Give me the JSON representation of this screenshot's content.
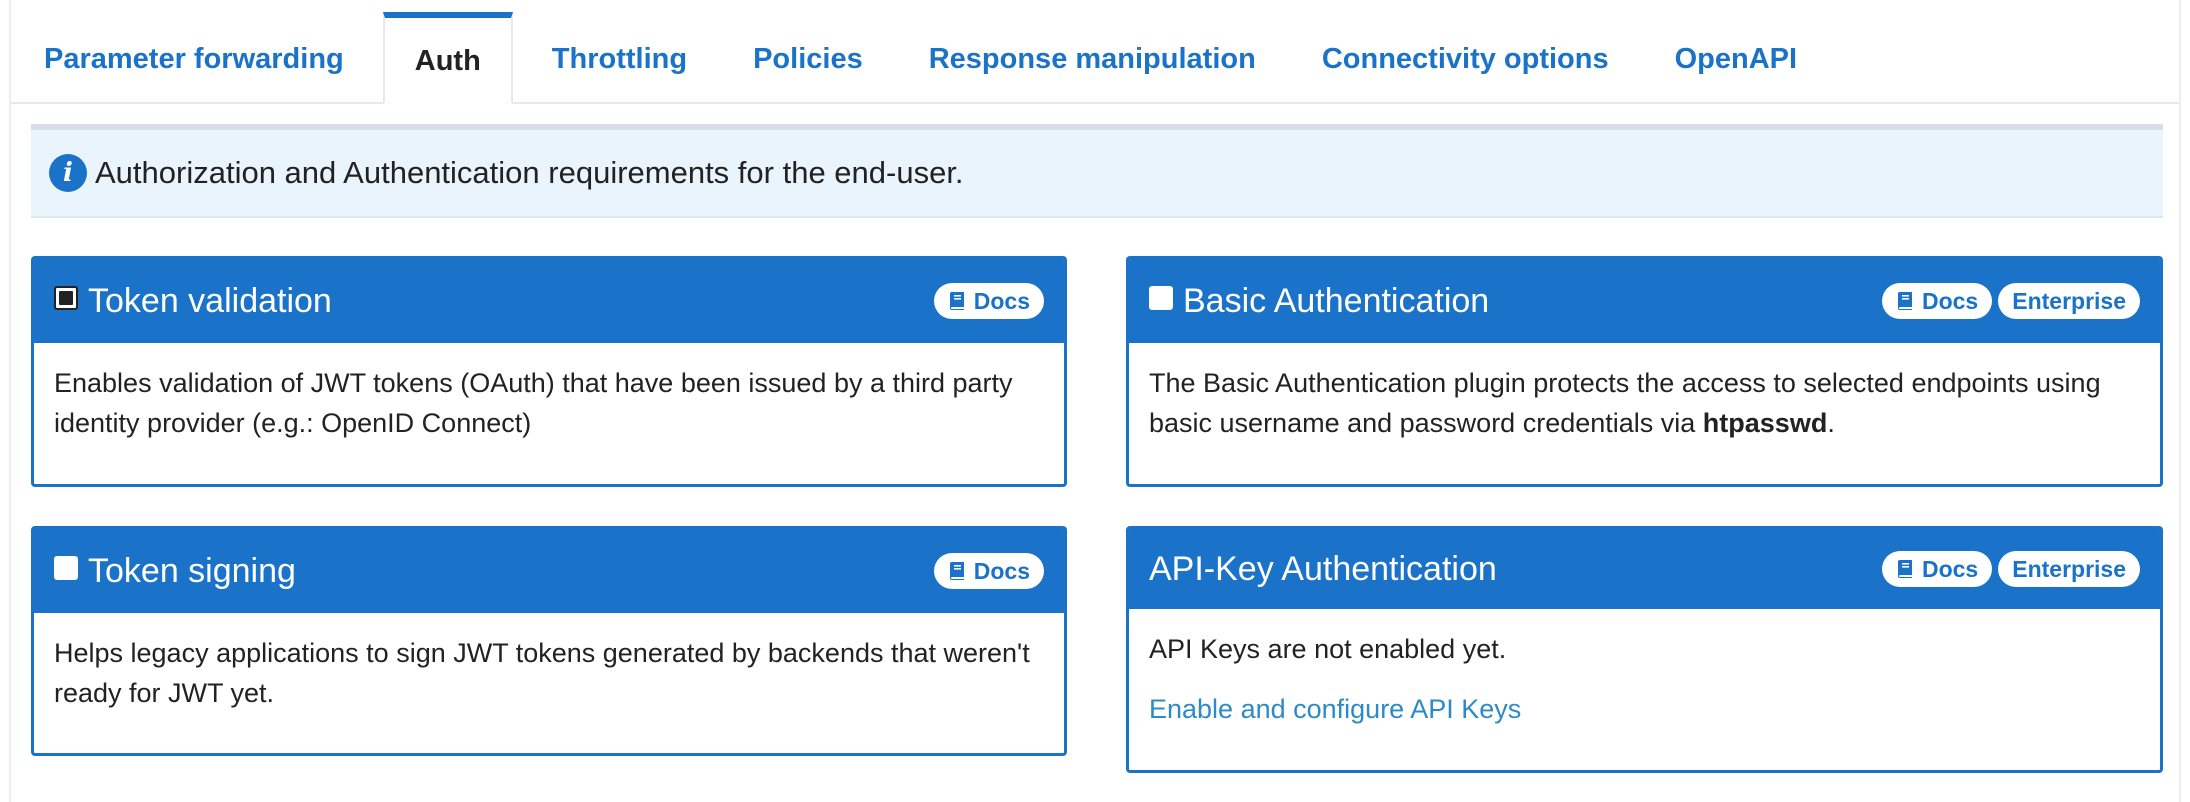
{
  "tabs": [
    {
      "label": "Parameter forwarding",
      "active": false
    },
    {
      "label": "Auth",
      "active": true
    },
    {
      "label": "Throttling",
      "active": false
    },
    {
      "label": "Policies",
      "active": false
    },
    {
      "label": "Response manipulation",
      "active": false
    },
    {
      "label": "Connectivity options",
      "active": false
    },
    {
      "label": "OpenAPI",
      "active": false
    }
  ],
  "info": {
    "icon": "info-icon",
    "text": "Authorization and Authentication requirements for the end-user."
  },
  "cards": {
    "token_validation": {
      "title": "Token validation",
      "checkbox_state": "indeterminate",
      "docs_label": "Docs",
      "description": "Enables validation of JWT tokens (OAuth) that have been issued by a third party identity provider (e.g.: OpenID Connect)"
    },
    "basic_auth": {
      "title": "Basic Authentication",
      "checkbox_state": "unchecked",
      "docs_label": "Docs",
      "enterprise_label": "Enterprise",
      "description_prefix": "The Basic Authentication plugin protects the access to selected endpoints using basic username and password credentials via ",
      "description_bold": "htpasswd",
      "description_suffix": "."
    },
    "token_signing": {
      "title": "Token signing",
      "checkbox_state": "unchecked",
      "docs_label": "Docs",
      "description": "Helps legacy applications to sign JWT tokens generated by backends that weren't ready for JWT yet."
    },
    "api_key": {
      "title": "API-Key Authentication",
      "docs_label": "Docs",
      "enterprise_label": "Enterprise",
      "note": "API Keys are not enabled yet.",
      "link": "Enable and configure API Keys"
    }
  },
  "colors": {
    "accent": "#1a73c8",
    "link": "#2c8ac9",
    "info_bg": "#eaf4fd"
  }
}
